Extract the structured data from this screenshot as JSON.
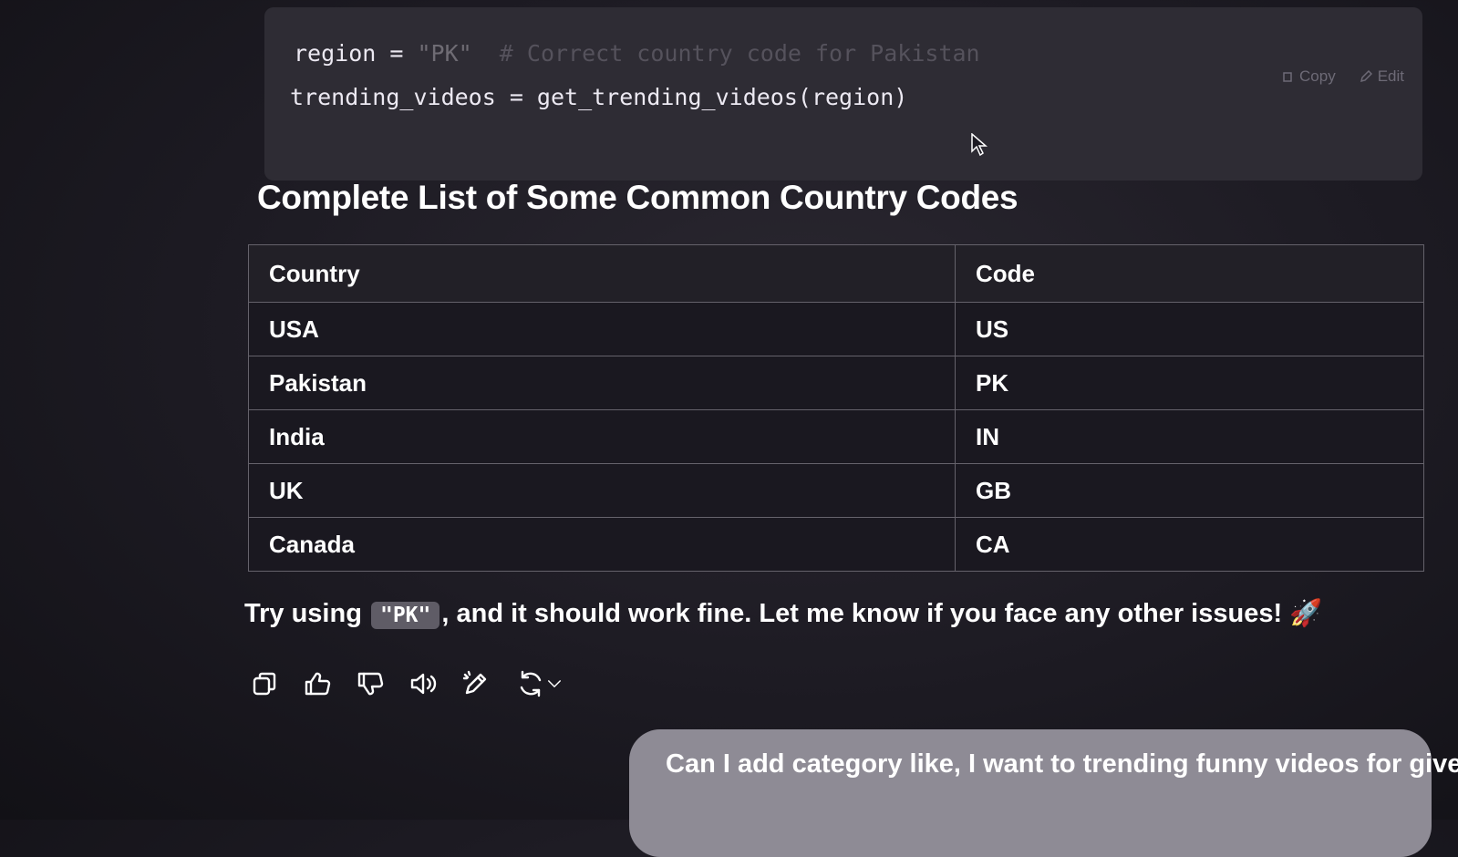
{
  "code": {
    "line1": {
      "name": "region = ",
      "string": "\"PK\"",
      "comment": "  # Correct country code for Pakistan"
    },
    "line2": "trending_videos = get_trending_videos(region)",
    "copy_label": "Copy",
    "edit_label": "Edit"
  },
  "section": {
    "title": "Complete List of Some Common Country Codes"
  },
  "table": {
    "headers": [
      "Country",
      "Code"
    ],
    "rows": [
      [
        "USA",
        "US"
      ],
      [
        "Pakistan",
        "PK"
      ],
      [
        "India",
        "IN"
      ],
      [
        "UK",
        "GB"
      ],
      [
        "Canada",
        "CA"
      ]
    ]
  },
  "reply": {
    "before": "Try using ",
    "code": "\"PK\"",
    "after": ", and it should work fine. Let me know if you face any other issues! 🚀"
  },
  "actions": [
    {
      "icon": "copy-icon"
    },
    {
      "icon": "thumbs-up-icon"
    },
    {
      "icon": "thumbs-down-icon"
    },
    {
      "icon": "speaker-icon"
    },
    {
      "icon": "edit-pencil-icon"
    },
    {
      "icon": "regenerate-icon"
    }
  ],
  "user_message": "Can I add category like, I want to trending funny videos for given"
}
